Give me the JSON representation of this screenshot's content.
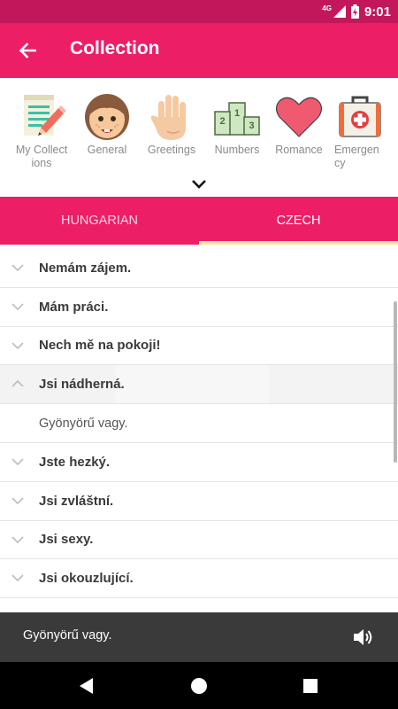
{
  "status_bar": {
    "network": "4G",
    "time": "9:01"
  },
  "app_bar": {
    "title": "Collection"
  },
  "categories": [
    {
      "label": "My Collect\nions",
      "icon": "notepad-pencil-icon"
    },
    {
      "label": "General",
      "icon": "girl-face-icon"
    },
    {
      "label": "Greetings",
      "icon": "waving-hand-icon"
    },
    {
      "label": "Numbers",
      "icon": "podium-icon"
    },
    {
      "label": "Romance",
      "icon": "heart-icon"
    },
    {
      "label": "Emergen\ncy",
      "icon": "first-aid-kit-icon"
    }
  ],
  "tabs": [
    {
      "label": "HUNGARIAN",
      "active": false
    },
    {
      "label": "CZECH",
      "active": true
    }
  ],
  "phrases": [
    {
      "text": "Nemám zájem.",
      "expanded": false
    },
    {
      "text": "Mám práci.",
      "expanded": false
    },
    {
      "text": "Nech mě na pokoji!",
      "expanded": false
    },
    {
      "text": "Jsi nádherná.",
      "expanded": true,
      "translation": "Gyönyörű vagy."
    },
    {
      "text": "Jste hezký.",
      "expanded": false
    },
    {
      "text": "Jsi zvláštní.",
      "expanded": false
    },
    {
      "text": "Jsi sexy.",
      "expanded": false
    },
    {
      "text": "Jsi okouzlující.",
      "expanded": false
    }
  ],
  "player": {
    "text": "Gyönyörű vagy."
  },
  "colors": {
    "primary": "#ec1e65",
    "status_bar": "#c2185b",
    "tab_indicator": "#f8e4a6",
    "player_bg": "#3a3a3a"
  }
}
